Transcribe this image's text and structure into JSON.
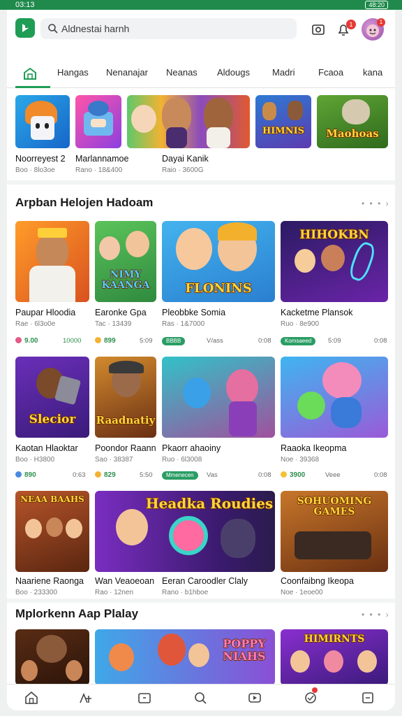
{
  "status": {
    "time": "03:13",
    "battery": "48:20"
  },
  "search": {
    "placeholder": "Aldnestai harnh"
  },
  "header": {
    "notif_count": "1"
  },
  "tabs": [
    "Hangas",
    "Nenanajar",
    "Neanas",
    "Aldougs",
    "Madri",
    "Fcaoa",
    "kana"
  ],
  "top_row": [
    {
      "title": "Noorreyest 2",
      "sub": "Boo · 8lo3oe"
    },
    {
      "title": "Marlannamoe",
      "sub": "Rano · 18&400"
    },
    {
      "title": "Dayai Kanik",
      "sub": "Raio · 3600G"
    },
    {
      "title": "",
      "sub": "",
      "art": "HIMNIS"
    },
    {
      "title": "",
      "sub": "",
      "art": "Maohoas"
    }
  ],
  "section1": {
    "title": "Arpban Helojen Hadoam",
    "more": "• • • ›"
  },
  "grid1": [
    {
      "title": "Paupar Hloodia",
      "sub": "Rae · 6l3o0e",
      "rating": "9.00",
      "pill": "",
      "price": "10000",
      "art": ""
    },
    {
      "title": "Earonke Gpa",
      "sub": "Tac · 13439",
      "rating": "899",
      "pill": "",
      "price": "5:09",
      "art": "NIMY KAANGA"
    },
    {
      "title": "Pleobbke Somia",
      "sub": "Ras · 1&7000",
      "rating": "",
      "pill": "BBBB",
      "price": "V/ass",
      "art": "FLONINS"
    },
    {
      "title": "Kacketme Plansok",
      "sub": "Ruo · 8e900",
      "rating": "",
      "pill": "Komsaeed",
      "price": "0:08",
      "art": "HIHOKBN"
    }
  ],
  "grid2": [
    {
      "title": "Kaotan Hlaoktar",
      "sub": "Boo · H3800",
      "rating": "890",
      "pill": "",
      "price": "0:63",
      "art": "Slecior"
    },
    {
      "title": "Poondor Raann",
      "sub": "Sao · 38387",
      "rating": "829",
      "pill": "",
      "price": "5:50",
      "art": "Raadnatiy"
    },
    {
      "title": "Pkaorr ahaoiny",
      "sub": "Ruo · 6l3008",
      "rating": "",
      "pill": "Mmenecen",
      "price": "Vas",
      "art": ""
    },
    {
      "title": "Raaoka Ikeopma",
      "sub": "Noe · 39368",
      "rating": "3900",
      "pill": "",
      "price": "Veee",
      "art": ""
    }
  ],
  "grid3": [
    {
      "title": "Naariene Raonga",
      "sub": "Boo · 233300",
      "art": "NEAA BAAHS"
    },
    {
      "title": "Wan Veaoeoan",
      "sub": "Rao · 12nen",
      "art": "Headka Roudies"
    },
    {
      "title": "Eeran Caroodler Claly",
      "sub": "Rano · b1hboe",
      "art": ""
    },
    {
      "title": "Coonfaibng Ikeopa",
      "sub": "Noe · 1eoe00",
      "art": "SOHUOMING GAMES"
    }
  ],
  "section2": {
    "title": "Mplorkenn Aap Plalay",
    "more": "• • • ›"
  },
  "grid4": [
    {
      "art": ""
    },
    {
      "art": "POPPY NIAHS"
    },
    {
      "art": "HIMIRNTS"
    }
  ],
  "colors": {
    "accent": "#1f9d55",
    "status_bar": "#1f8a4c",
    "badge": "#e53935"
  },
  "icons": [
    "search-icon",
    "camera-icon",
    "bell-icon",
    "home-icon",
    "games-icon",
    "apps-icon",
    "search-icon",
    "video-icon",
    "chat-icon",
    "library-icon"
  ]
}
